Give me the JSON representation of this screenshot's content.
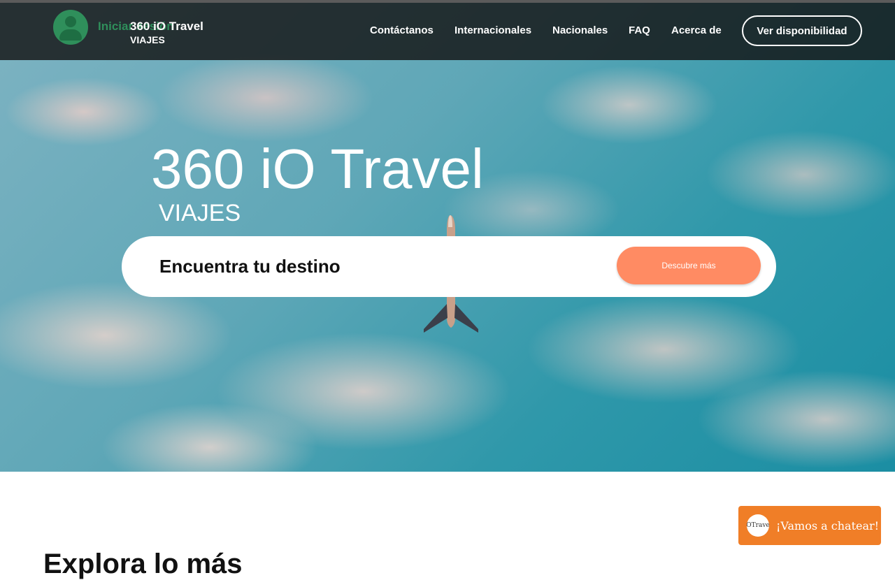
{
  "header": {
    "login_label": "Iniciar sesión",
    "brand_title": "360 iO Travel",
    "brand_sub": "VIAJES",
    "nav": [
      {
        "label": "Contáctanos"
      },
      {
        "label": "Internacionales"
      },
      {
        "label": "Nacionales"
      },
      {
        "label": "FAQ"
      },
      {
        "label": "Acerca de"
      }
    ],
    "cta_label": "Ver disponibilidad"
  },
  "hero": {
    "title": "360 iO Travel",
    "subtitle": "VIAJES",
    "search_label": "Encuentra tu destino",
    "discover_label": "Descubre más"
  },
  "section": {
    "heading": "Explora lo más"
  },
  "chat": {
    "logo_text": "iOTravel",
    "label": "¡Vamos a chatear!"
  },
  "colors": {
    "accent": "#ff8b63",
    "chat": "#f07e27",
    "login": "#2f8f5b",
    "topbar": "#141414"
  },
  "icons": {
    "avatar": "user-avatar-icon",
    "plane": "airplane-icon"
  }
}
